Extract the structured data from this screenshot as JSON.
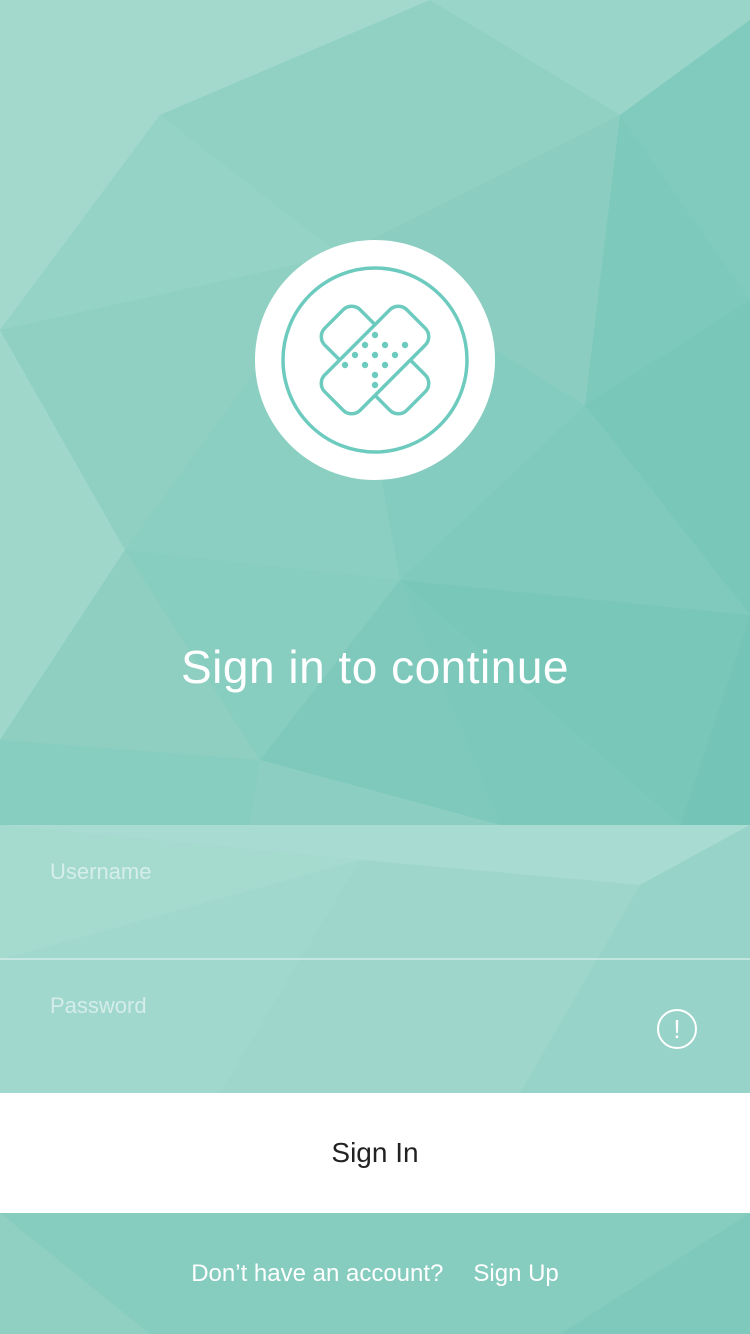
{
  "colors": {
    "background": "#8ccfc2",
    "accent": "#6ccbbe",
    "button_background": "#ffffff",
    "button_text": "#222222"
  },
  "logo": {
    "icon": "bandage-icon"
  },
  "title": "Sign in to continue",
  "form": {
    "username_placeholder": "Username",
    "password_placeholder": "Password",
    "password_status_icon": "alert-icon",
    "password_status_symbol": "!"
  },
  "sign_in_button": {
    "label": "Sign In"
  },
  "footer": {
    "prompt": "Don’t have an account?",
    "link": "Sign Up"
  }
}
